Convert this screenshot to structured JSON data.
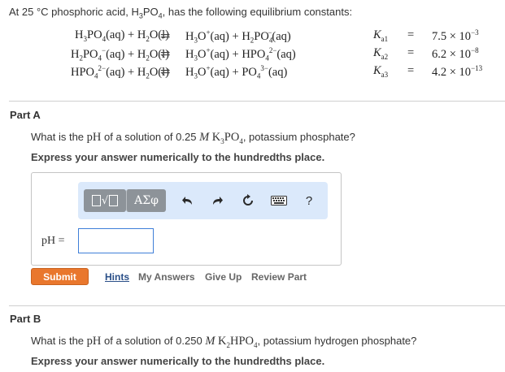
{
  "intro": {
    "prefix": "At 25 °C phosphoric acid, H",
    "formula_sub1": "3",
    "formula_mid": "PO",
    "formula_sub2": "4",
    "suffix": ", has the following equilibrium constants:"
  },
  "equilibria": [
    {
      "left": [
        "H",
        "3",
        "PO",
        "4",
        "(aq) + H",
        "2",
        "O(l)"
      ],
      "arrow": "⇌",
      "right": [
        "H",
        "3",
        "O",
        "+",
        "(aq) + H",
        "2",
        "PO",
        "4",
        "−",
        "(aq)"
      ],
      "k": "K",
      "k_sub": "a1",
      "eq": "=",
      "value": "7.5 × 10",
      "exp": "−3"
    },
    {
      "left": [
        "H",
        "2",
        "PO",
        "4",
        "−",
        "(aq) + H",
        "2",
        "O(l)"
      ],
      "arrow": "⇌",
      "right": [
        "H",
        "3",
        "O",
        "+",
        "(aq) + HPO",
        "4",
        "2−",
        "(aq)"
      ],
      "k": "K",
      "k_sub": "a2",
      "eq": "=",
      "value": "6.2 × 10",
      "exp": "−8"
    },
    {
      "left": [
        "HPO",
        "4",
        "2−",
        "(aq) + H",
        "2",
        "O(l)"
      ],
      "arrow": "⇌",
      "right": [
        "H",
        "3",
        "O",
        "+",
        "(aq) + PO",
        "4",
        "3−",
        "(aq)"
      ],
      "k": "K",
      "k_sub": "a3",
      "eq": "=",
      "value": "4.2 × 10",
      "exp": "−13"
    }
  ],
  "partA": {
    "title": "Part A",
    "question_prefix": "What is the ",
    "question_pH": "pH",
    "question_mid": " of a solution of 0.25 ",
    "question_M": "M",
    "question_formula": "K",
    "question_sub1": "3",
    "question_formula2": "PO",
    "question_sub2": "4",
    "question_suffix": ", potassium phosphate?",
    "instruction": "Express your answer numerically to the hundredths place.",
    "toolbar": {
      "greek_label": "ΑΣφ",
      "help_label": "?",
      "icons": [
        "templates-icon",
        "greek-symbols-icon",
        "undo-icon",
        "redo-icon",
        "reset-icon",
        "keyboard-icon",
        "help-icon"
      ]
    },
    "input_label": "pH =",
    "input_value": "",
    "submit_label": "Submit",
    "links": [
      "Hints",
      "My Answers",
      "Give Up",
      "Review Part"
    ]
  },
  "partB": {
    "title": "Part B",
    "question_prefix": "What is the ",
    "question_pH": "pH",
    "question_mid": " of a solution of 0.250 ",
    "question_M": "M",
    "question_formula": "K",
    "question_sub1": "2",
    "question_formula2": "HPO",
    "question_sub2": "4",
    "question_suffix": ", potassium hydrogen phosphate?",
    "instruction": "Express your answer numerically to the hundredths place."
  },
  "colors": {
    "submit": "#e9772d",
    "toolbar_bg": "#dbe9fb",
    "toolbar_btn": "#8d9399",
    "input_border": "#3f7fd8",
    "link_active": "#2a4f88"
  }
}
